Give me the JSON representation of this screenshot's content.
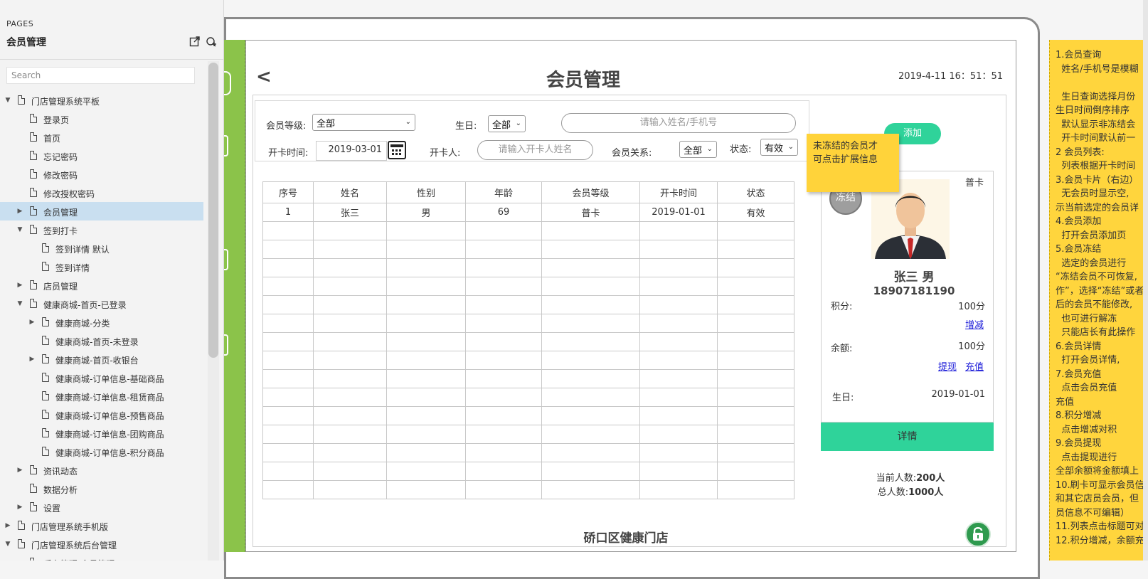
{
  "sidebar": {
    "section_label": "PAGES",
    "title": "会员管理",
    "search_placeholder": "Search",
    "tree": [
      {
        "label": "门店管理系统平板",
        "arrow": "down"
      },
      {
        "label": "登录页",
        "arrow": ""
      },
      {
        "label": "首页",
        "arrow": ""
      },
      {
        "label": "忘记密码",
        "arrow": ""
      },
      {
        "label": "修改密码",
        "arrow": ""
      },
      {
        "label": "修改授权密码",
        "arrow": ""
      },
      {
        "label": "会员管理",
        "arrow": "right",
        "selected": true
      },
      {
        "label": "签到打卡",
        "arrow": "down"
      },
      {
        "label": "签到详情 默认",
        "arrow": ""
      },
      {
        "label": "签到详情",
        "arrow": ""
      },
      {
        "label": "店员管理",
        "arrow": "right"
      },
      {
        "label": "健康商城-首页-已登录",
        "arrow": "down"
      },
      {
        "label": "健康商城-分类",
        "arrow": "right"
      },
      {
        "label": "健康商城-首页-未登录",
        "arrow": ""
      },
      {
        "label": "健康商城-首页-收银台",
        "arrow": "right"
      },
      {
        "label": "健康商城-订单信息-基础商品",
        "arrow": ""
      },
      {
        "label": "健康商城-订单信息-租赁商品",
        "arrow": ""
      },
      {
        "label": "健康商城-订单信息-预售商品",
        "arrow": ""
      },
      {
        "label": "健康商城-订单信息-团购商品",
        "arrow": ""
      },
      {
        "label": "健康商城-订单信息-积分商品",
        "arrow": ""
      },
      {
        "label": "资讯动态",
        "arrow": "right"
      },
      {
        "label": "数据分析",
        "arrow": ""
      },
      {
        "label": "设置",
        "arrow": "right"
      },
      {
        "label": "门店管理系统手机版",
        "arrow": "right"
      },
      {
        "label": "门店管理系统后台管理",
        "arrow": "down"
      },
      {
        "label": "后台管理-会员管理",
        "arrow": ""
      }
    ]
  },
  "app": {
    "back": "<",
    "title": "会员管理",
    "datetime": "2019-4-11  16：51：51",
    "store_name": "硚口区健康门店"
  },
  "filters": {
    "level_label": "会员等级:",
    "level_value": "全部",
    "birthday_label": "生日:",
    "birthday_value": "全部",
    "search_placeholder": "请输入姓名/手机号",
    "open_date_label": "开卡时间:",
    "open_date_value": "2019-03-01",
    "opener_label": "开卡人:",
    "opener_placeholder": "请输入开卡人姓名",
    "relation_label": "会员关系:",
    "relation_value": "全部",
    "status_label": "状态:",
    "status_value": "有效",
    "add_button": "添加"
  },
  "table": {
    "headers": [
      "序号",
      "姓名",
      "性别",
      "年龄",
      "会员等级",
      "开卡时间",
      "状态"
    ],
    "rows": [
      [
        "1",
        "张三",
        "男",
        "69",
        "普卡",
        "2019-01-01",
        "有效"
      ]
    ]
  },
  "card": {
    "level": "普卡",
    "frozen_badge": "冻结",
    "name": "张三   男",
    "phone": "18907181190",
    "points_label": "积分:",
    "points_value": "100分",
    "points_link": "增减",
    "balance_label": "余额:",
    "balance_value": "100分",
    "withdraw_link": "提现",
    "recharge_link": "充值",
    "birthday_label": "生日:",
    "birthday_value": "2019-01-01",
    "detail_button": "详情",
    "current_count_label": "当前人数:",
    "current_count_value": "200人",
    "total_count_label": "总人数:",
    "total_count_value": "1000人"
  },
  "sticky_note": {
    "line1": "未冻结的会员才",
    "line2": "可点击扩展信息"
  },
  "notes": [
    "1.会员查询",
    "  姓名/手机号是模糊",
    "",
    "  生日查询选择月份",
    "生日时间倒序排序",
    "  默认显示非冻结会",
    "  开卡时间默认前一",
    "2 会员列表:",
    "  列表根据开卡时间",
    "3.会员卡片（右边）",
    "  无会员时显示空,",
    "示当前选定的会员详",
    "4.会员添加",
    "  打开会员添加页",
    "5.会员冻结",
    "  选定的会员进行",
    "“冻结会员不可恢复,",
    "作”，选择“冻结”或者",
    "后的会员不能修改,",
    "  也可进行解冻",
    "  只能店长有此操作",
    "6.会员详情",
    "  打开会员详情,",
    "7.会员充值",
    "  点击会员充值",
    "充值",
    "8.积分增减",
    "  点击增减对积",
    "9.会员提现",
    "  点击提现进行",
    "全部余额将金额填上",
    "10.刷卡可显示会员信",
    "和其它店员会员，但",
    "员信息不可编辑）",
    "11.列表点击标题可对",
    "12.积分增减，余额充"
  ]
}
